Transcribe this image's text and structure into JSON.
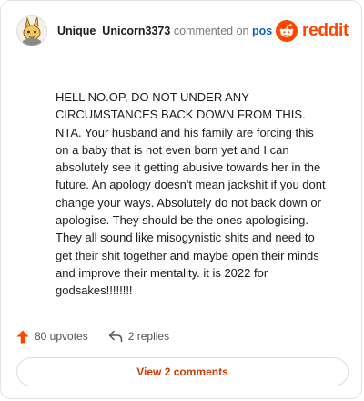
{
  "comment": {
    "username": "Unique_Unicorn3373",
    "action_text": "commented on",
    "link_text": "post",
    "body": "HELL NO.OP, DO NOT UNDER ANY CIRCUMSTANCES BACK DOWN FROM THIS. NTA. Your husband and his family are forcing this on a baby that is not even born yet and I can absolutely see it getting abusive towards her in the future. An apology doesn't mean jackshit if you dont change your ways. Absolutely do not back down or apologise. They should be the ones apologising. They all sound like misogynistic shits and need to get their shit together and maybe open their minds and improve their mentality. it is 2022 for godsakes!!!!!!!!",
    "upvotes": "80 upvotes",
    "replies": "2 replies",
    "view_button": "View 2 comments"
  },
  "brand": {
    "wordmark": "reddit",
    "color": "#ff4500"
  },
  "icons": {
    "avatar": "unicorn-avatar-icon",
    "logo": "reddit-logo-icon",
    "upvote": "upvote-arrow-icon",
    "reply": "reply-arrow-icon"
  },
  "colors": {
    "upvote": "#ff4500",
    "view_button_text": "#d23c00",
    "link": "#0a66c2"
  }
}
